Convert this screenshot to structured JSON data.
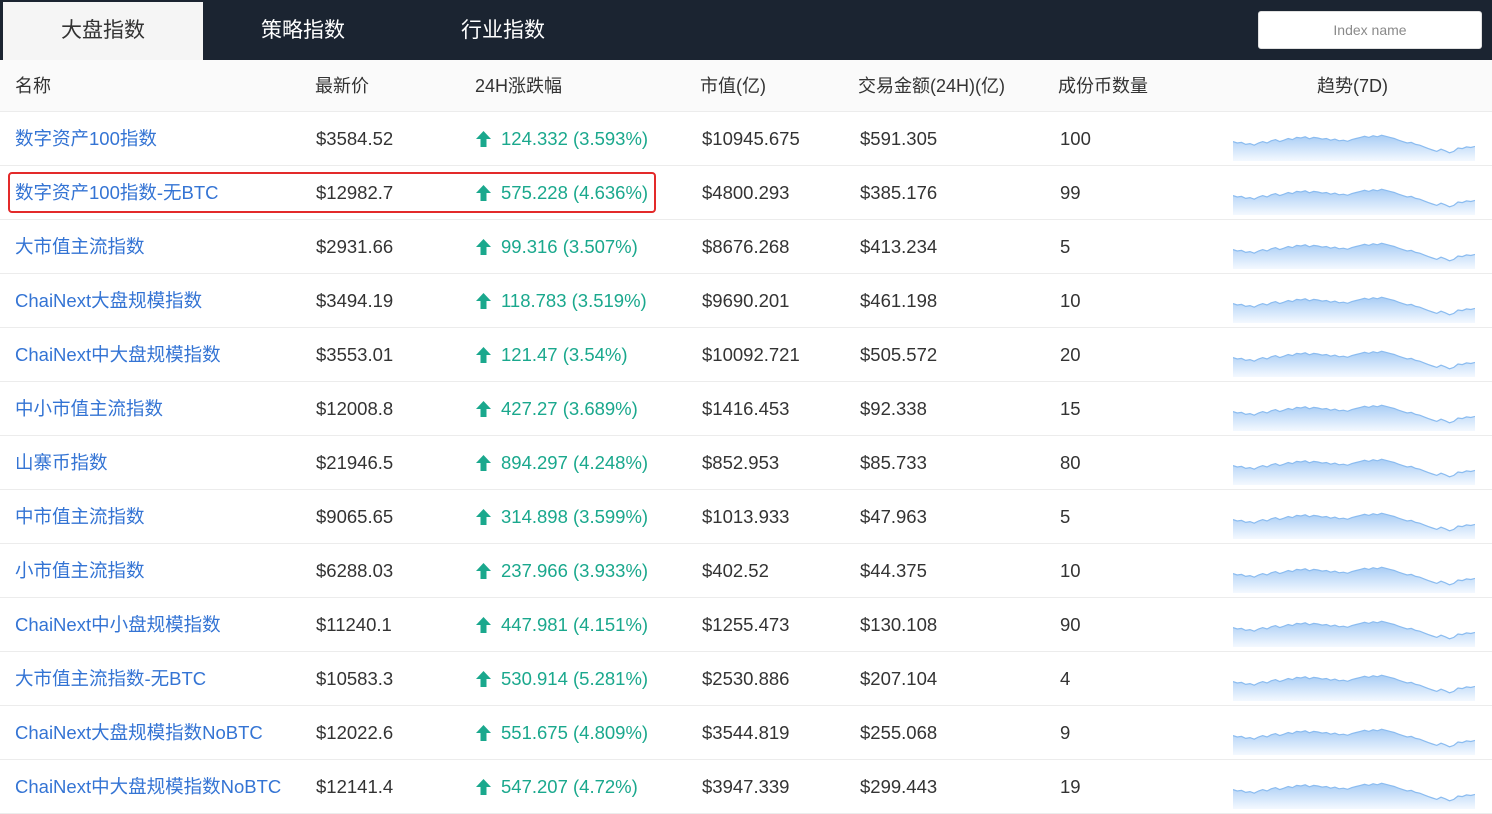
{
  "tabs": [
    {
      "label": "大盘指数",
      "active": true
    },
    {
      "label": "策略指数",
      "active": false
    },
    {
      "label": "行业指数",
      "active": false
    }
  ],
  "search": {
    "placeholder": "Index name"
  },
  "columns": {
    "name": "名称",
    "price": "最新价",
    "change": "24H涨跌幅",
    "market_cap": "市值(亿)",
    "volume": "交易金额(24H)(亿)",
    "components": "成份币数量",
    "trend": "趋势(7D)"
  },
  "rows": [
    {
      "name": "数字资产100指数",
      "price": "$3584.52",
      "change": "124.332 (3.593%)",
      "market_cap": "$10945.675",
      "volume": "$591.305",
      "components": "100"
    },
    {
      "name": "数字资产100指数-无BTC",
      "price": "$12982.7",
      "change": "575.228 (4.636%)",
      "market_cap": "$4800.293",
      "volume": "$385.176",
      "components": "99"
    },
    {
      "name": "大市值主流指数",
      "price": "$2931.66",
      "change": "99.316 (3.507%)",
      "market_cap": "$8676.268",
      "volume": "$413.234",
      "components": "5"
    },
    {
      "name": "ChaiNext大盘规模指数",
      "price": "$3494.19",
      "change": "118.783 (3.519%)",
      "market_cap": "$9690.201",
      "volume": "$461.198",
      "components": "10"
    },
    {
      "name": "ChaiNext中大盘规模指数",
      "price": "$3553.01",
      "change": "121.47 (3.54%)",
      "market_cap": "$10092.721",
      "volume": "$505.572",
      "components": "20"
    },
    {
      "name": "中小市值主流指数",
      "price": "$12008.8",
      "change": "427.27 (3.689%)",
      "market_cap": "$1416.453",
      "volume": "$92.338",
      "components": "15"
    },
    {
      "name": "山寨币指数",
      "price": "$21946.5",
      "change": "894.297 (4.248%)",
      "market_cap": "$852.953",
      "volume": "$85.733",
      "components": "80"
    },
    {
      "name": "中市值主流指数",
      "price": "$9065.65",
      "change": "314.898 (3.599%)",
      "market_cap": "$1013.933",
      "volume": "$47.963",
      "components": "5"
    },
    {
      "name": "小市值主流指数",
      "price": "$6288.03",
      "change": "237.966 (3.933%)",
      "market_cap": "$402.52",
      "volume": "$44.375",
      "components": "10"
    },
    {
      "name": "ChaiNext中小盘规模指数",
      "price": "$11240.1",
      "change": "447.981 (4.151%)",
      "market_cap": "$1255.473",
      "volume": "$130.108",
      "components": "90"
    },
    {
      "name": "大市值主流指数-无BTC",
      "price": "$10583.3",
      "change": "530.914 (5.281%)",
      "market_cap": "$2530.886",
      "volume": "$207.104",
      "components": "4"
    },
    {
      "name": "ChaiNext大盘规模指数NoBTC",
      "price": "$12022.6",
      "change": "551.675 (4.809%)",
      "market_cap": "$3544.819",
      "volume": "$255.068",
      "components": "9"
    },
    {
      "name": "ChaiNext中大盘规模指数NoBTC",
      "price": "$12141.4",
      "change": "547.207 (4.72%)",
      "market_cap": "$3947.339",
      "volume": "$299.443",
      "components": "19"
    }
  ],
  "sparkline": {
    "values": [
      0.55,
      0.5,
      0.52,
      0.45,
      0.48,
      0.42,
      0.5,
      0.55,
      0.5,
      0.58,
      0.62,
      0.55,
      0.6,
      0.66,
      0.62,
      0.7,
      0.68,
      0.72,
      0.65,
      0.7,
      0.68,
      0.64,
      0.66,
      0.6,
      0.64,
      0.58,
      0.6,
      0.56,
      0.62,
      0.66,
      0.7,
      0.74,
      0.7,
      0.76,
      0.72,
      0.78,
      0.74,
      0.7,
      0.66,
      0.6,
      0.55,
      0.5,
      0.52,
      0.45,
      0.42,
      0.36,
      0.3,
      0.25,
      0.2,
      0.28,
      0.22,
      0.15,
      0.2,
      0.32,
      0.3,
      0.36,
      0.34,
      0.38
    ],
    "line_color": "#8bbcf0",
    "fill_top": "#a9cdf5",
    "fill_bottom": "#f4f9ff"
  },
  "colors": {
    "topbar": "#1b2431",
    "link": "#3474d4",
    "up": "#1aa88d",
    "highlight": "#e32a2a"
  },
  "highlight_row_index": 1
}
